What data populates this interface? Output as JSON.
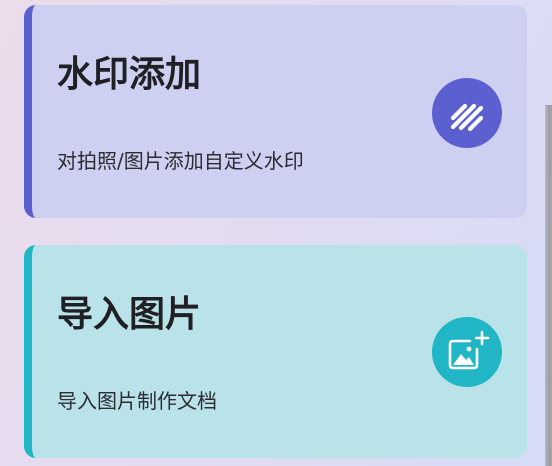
{
  "cards": [
    {
      "title": "水印添加",
      "subtitle": "对拍照/图片添加自定义水印",
      "icon": "watermark-icon",
      "accent_color": "#5b5fd0",
      "background_color": "#cdd0f1"
    },
    {
      "title": "导入图片",
      "subtitle": "导入图片制作文档",
      "icon": "image-add-icon",
      "accent_color": "#20b6c5",
      "background_color": "#b9e3e9"
    }
  ]
}
